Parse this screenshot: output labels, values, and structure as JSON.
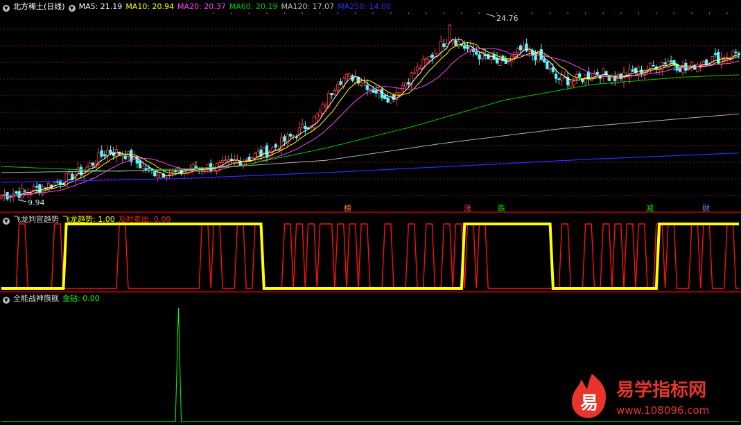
{
  "colors": {
    "bg": "#000000",
    "grid": "#7a1a1a",
    "divider": "#8b0000",
    "up": "#ff4040",
    "down": "#54fcfc",
    "ma5": "#ffffff",
    "ma10": "#ffff00",
    "ma20": "#ff44ff",
    "ma60": "#00cc00",
    "ma120": "#b0b0b0",
    "ma250": "#2a2aff",
    "trend": "#ffff00",
    "sell": "#ff1010",
    "diamond": "#00ff00",
    "event_dots": "#ff33ff"
  },
  "panel1": {
    "title": "北方稀土(日线)",
    "ma": [
      {
        "label": "MA5: 21.19",
        "color": "#ffffff"
      },
      {
        "label": "MA10: 20.94",
        "color": "#ffff00"
      },
      {
        "label": "MA20: 20.37",
        "color": "#ff44ff"
      },
      {
        "label": "MA60: 20.19",
        "color": "#00cc00"
      },
      {
        "label": "MA120: 17.07",
        "color": "#c0c0c0"
      },
      {
        "label": "MA250: 14.00",
        "color": "#3030ff"
      }
    ],
    "high_label": "24.76",
    "low_label": "9.94",
    "markers": [
      {
        "text": "榜",
        "color": "#ff8040"
      },
      {
        "text": "涨",
        "color": "#ff4040"
      },
      {
        "text": "跌",
        "color": "#00e000"
      },
      {
        "text": "减",
        "color": "#00e000"
      },
      {
        "text": "财",
        "color": "#5fa0ff"
      }
    ]
  },
  "panel2": {
    "title": "飞龙判官趋势",
    "line1": "飞龙趋势: 1.00",
    "line2": "及时卖出: 0.00"
  },
  "panel3": {
    "title": "全能战神旗舰",
    "line1": "金钻: 0.00"
  },
  "watermark": {
    "logo_char": "易",
    "name": "易学指标网",
    "url": "www.108096.com"
  },
  "chart_data": [
    {
      "type": "candlestick",
      "title": "北方稀土(日线)",
      "ylim": [
        9.5,
        25.5
      ],
      "extremes": {
        "high": 24.76,
        "low": 9.94
      },
      "ma_last": {
        "MA5": 21.19,
        "MA10": 20.94,
        "MA20": 20.37,
        "MA60": 20.19,
        "MA120": 17.07,
        "MA250": 14.0
      },
      "close_anchors": [
        [
          0,
          10.5
        ],
        [
          10,
          10.9
        ],
        [
          20,
          11.7
        ],
        [
          28,
          12.6
        ],
        [
          36,
          14.2
        ],
        [
          42,
          13.9
        ],
        [
          50,
          12.5
        ],
        [
          58,
          12.3
        ],
        [
          66,
          12.8
        ],
        [
          74,
          12.9
        ],
        [
          82,
          13.5
        ],
        [
          90,
          14.1
        ],
        [
          100,
          15.6
        ],
        [
          108,
          17.2
        ],
        [
          114,
          20.0
        ],
        [
          120,
          20.3
        ],
        [
          126,
          19.2
        ],
        [
          132,
          18.5
        ],
        [
          140,
          20.6
        ],
        [
          146,
          22.0
        ],
        [
          152,
          23.6
        ],
        [
          158,
          22.5
        ],
        [
          164,
          21.8
        ],
        [
          170,
          21.2
        ],
        [
          176,
          22.4
        ],
        [
          182,
          21.9
        ],
        [
          188,
          20.1
        ],
        [
          194,
          19.9
        ],
        [
          202,
          20.6
        ],
        [
          208,
          20.2
        ],
        [
          214,
          20.6
        ],
        [
          220,
          21.0
        ],
        [
          226,
          21.6
        ],
        [
          232,
          20.8
        ],
        [
          238,
          21.6
        ],
        [
          244,
          21.8
        ],
        [
          250,
          22.3
        ]
      ],
      "ma60_anchors": [
        [
          0,
          12.9
        ],
        [
          40,
          12.5
        ],
        [
          80,
          12.9
        ],
        [
          110,
          14.4
        ],
        [
          140,
          16.2
        ],
        [
          170,
          18.3
        ],
        [
          200,
          19.6
        ],
        [
          230,
          20.2
        ],
        [
          250,
          20.4
        ]
      ],
      "ma120_anchors": [
        [
          0,
          12.4
        ],
        [
          60,
          12.6
        ],
        [
          110,
          13.4
        ],
        [
          150,
          14.8
        ],
        [
          190,
          16.0
        ],
        [
          230,
          16.8
        ],
        [
          250,
          17.2
        ]
      ],
      "ma250_anchors": [
        [
          0,
          11.6
        ],
        [
          60,
          11.9
        ],
        [
          110,
          12.4
        ],
        [
          160,
          13.0
        ],
        [
          200,
          13.5
        ],
        [
          250,
          14.0
        ]
      ]
    },
    {
      "type": "step-line",
      "title": "飞龙判官趋势",
      "series": [
        {
          "name": "飞龙趋势",
          "last": 1.0,
          "on_segments": [
            [
              22,
              88
            ],
            [
              157,
              186
            ],
            [
              223,
              250
            ]
          ]
        },
        {
          "name": "及时卖出",
          "last": 0.0,
          "spike_starts": [
            6,
            18,
            40,
            68,
            72,
            80,
            86,
            96,
            100,
            104,
            108,
            110,
            114,
            118,
            122,
            130,
            138,
            144,
            150,
            154,
            158,
            162,
            190,
            198,
            204,
            208,
            212,
            216,
            222,
            226,
            234,
            238,
            246
          ]
        }
      ],
      "ylim": [
        0,
        1
      ]
    },
    {
      "type": "line",
      "title": "全能战神旗舰",
      "series": [
        {
          "name": "金钻",
          "last": 0.0,
          "spikes": [
            [
              60,
              1.0
            ]
          ]
        }
      ],
      "ylim": [
        0,
        1
      ]
    }
  ]
}
